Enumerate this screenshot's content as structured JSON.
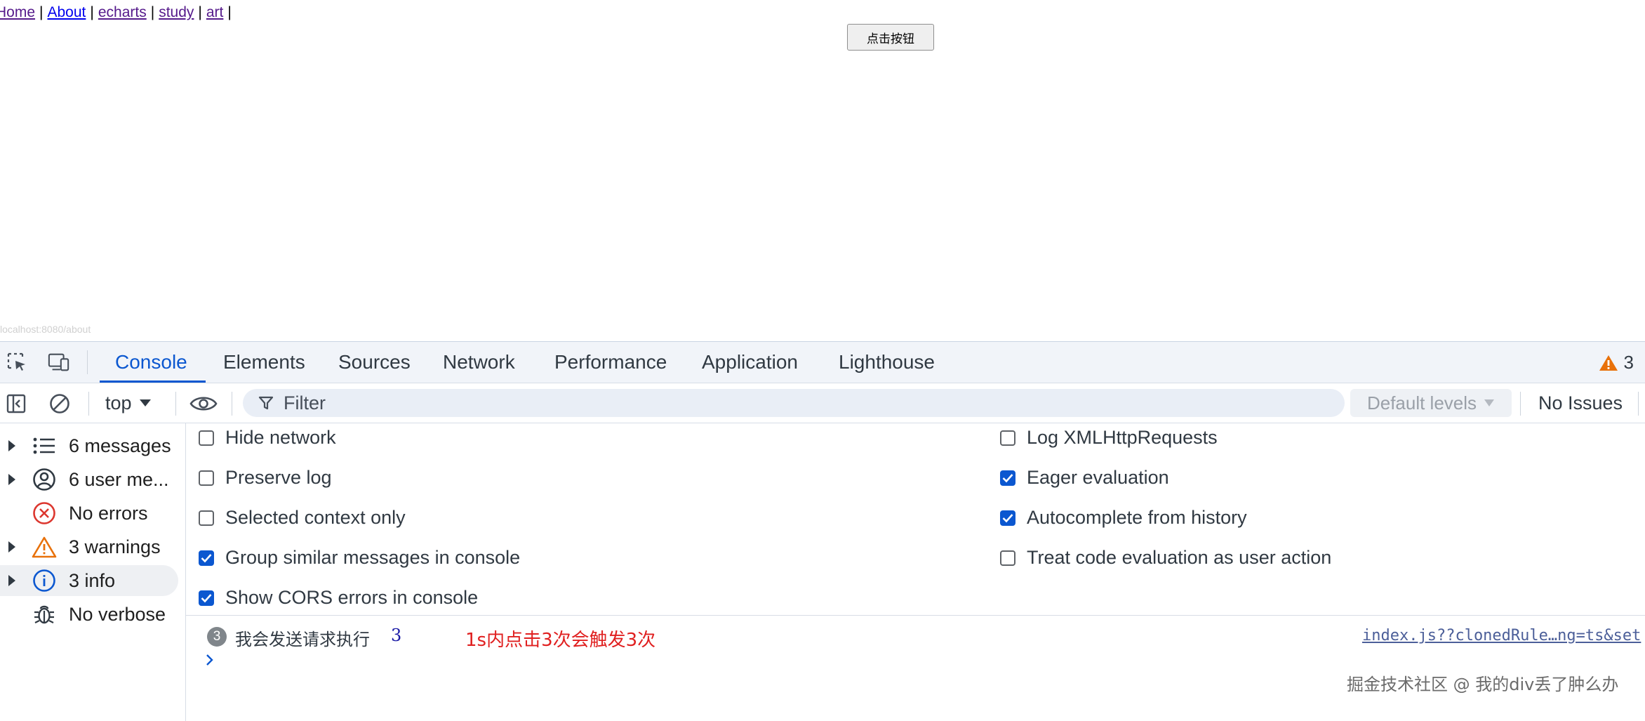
{
  "page": {
    "nav_links": [
      "Home",
      "About",
      "echarts",
      "study",
      "art"
    ],
    "nav_separator": "|",
    "button_label": "点击按钮",
    "status_url": "localhost:8080/about"
  },
  "devtools": {
    "tabs": [
      "Console",
      "Elements",
      "Sources",
      "Network",
      "Performance",
      "Application",
      "Lighthouse"
    ],
    "active_tab": "Console",
    "warning_count": "3",
    "toolbar": {
      "context": "top",
      "filter_placeholder": "Filter",
      "levels": "Default levels",
      "issues": "No Issues"
    },
    "sidebar": [
      {
        "label": "6 messages",
        "icon": "list-icon"
      },
      {
        "label": "6 user me...",
        "icon": "user-icon"
      },
      {
        "label": "No errors",
        "icon": "error-icon"
      },
      {
        "label": "3 warnings",
        "icon": "warning-icon"
      },
      {
        "label": "3 info",
        "icon": "info-icon"
      },
      {
        "label": "No verbose",
        "icon": "bug-icon"
      }
    ],
    "settings_left": [
      {
        "label": "Hide network",
        "checked": false
      },
      {
        "label": "Preserve log",
        "checked": false
      },
      {
        "label": "Selected context only",
        "checked": false
      },
      {
        "label": "Group similar messages in console",
        "checked": true
      },
      {
        "label": "Show CORS errors in console",
        "checked": true
      }
    ],
    "settings_right": [
      {
        "label": "Log XMLHttpRequests",
        "checked": false
      },
      {
        "label": "Eager evaluation",
        "checked": true
      },
      {
        "label": "Autocomplete from history",
        "checked": true
      },
      {
        "label": "Treat code evaluation as user action",
        "checked": false
      }
    ],
    "console": {
      "repeat_count": "3",
      "message_text": "我会发送请求执行",
      "message_value": "3",
      "source": "index.js??clonedRule…ng=ts&set",
      "annotation": "1s内点击3次会触发3次",
      "watermark": "掘金技术社区 @ 我的div丢了肿么办"
    }
  }
}
